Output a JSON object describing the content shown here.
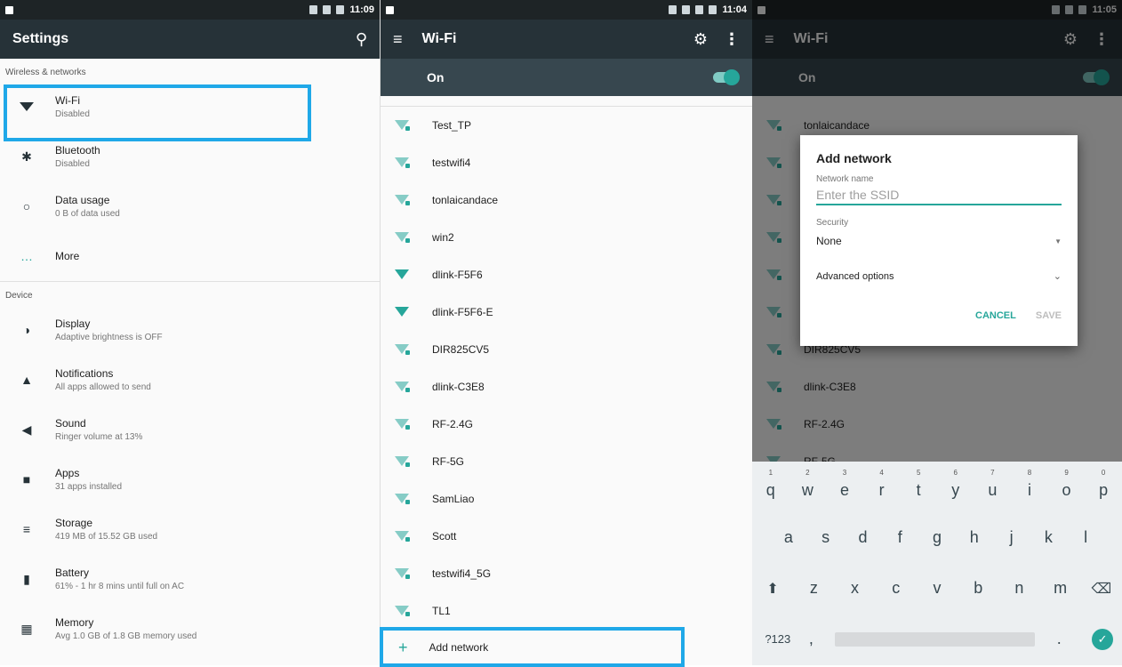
{
  "panel1": {
    "status_time": "11:09",
    "toolbar_title": "Settings",
    "sections": [
      {
        "header": "Wireless & networks",
        "items": [
          {
            "title": "Wi-Fi",
            "subtitle": "Disabled",
            "icon": "wifi-icon"
          },
          {
            "title": "Bluetooth",
            "subtitle": "Disabled",
            "icon": "bluetooth-icon"
          },
          {
            "title": "Data usage",
            "subtitle": "0 B of data used",
            "icon": "data-usage-icon"
          },
          {
            "title": "More",
            "subtitle": "",
            "icon": "more-icon"
          }
        ]
      },
      {
        "header": "Device",
        "items": [
          {
            "title": "Display",
            "subtitle": "Adaptive brightness is OFF",
            "icon": "brightness-icon"
          },
          {
            "title": "Notifications",
            "subtitle": "All apps allowed to send",
            "icon": "bell-icon"
          },
          {
            "title": "Sound",
            "subtitle": "Ringer volume at 13%",
            "icon": "volume-icon"
          },
          {
            "title": "Apps",
            "subtitle": "31 apps installed",
            "icon": "android-icon"
          },
          {
            "title": "Storage",
            "subtitle": "419 MB of 15.52 GB used",
            "icon": "storage-icon"
          },
          {
            "title": "Battery",
            "subtitle": "61% - 1 hr 8 mins until full on AC",
            "icon": "battery-icon"
          },
          {
            "title": "Memory",
            "subtitle": "Avg 1.0 GB of 1.8 GB memory used",
            "icon": "memory-icon"
          }
        ]
      }
    ]
  },
  "panel2": {
    "status_time": "11:04",
    "toolbar_title": "Wi-Fi",
    "switch_label": "On",
    "networks": [
      "Test_TP",
      "testwifi4",
      "tonlaicandace",
      "win2",
      "dlink-F5F6",
      "dlink-F5F6-E",
      "DIR825CV5",
      "dlink-C3E8",
      "RF-2.4G",
      "RF-5G",
      "SamLiao",
      "Scott",
      "testwifi4_5G",
      "TL1"
    ],
    "add_network": "Add network"
  },
  "panel3": {
    "status_time": "11:05",
    "toolbar_title": "Wi-Fi",
    "switch_label": "On",
    "background_networks": [
      "tonlaicandace",
      "DIR825CV5",
      "dlink-C3E8",
      "RF-2.4G",
      "RF-5G"
    ],
    "dialog": {
      "title": "Add network",
      "network_name_label": "Network name",
      "ssid_placeholder": "Enter the SSID",
      "security_label": "Security",
      "security_value": "None",
      "advanced_options": "Advanced options",
      "cancel": "CANCEL",
      "save": "SAVE"
    },
    "keyboard": {
      "row1": [
        "q",
        "w",
        "e",
        "r",
        "t",
        "y",
        "u",
        "i",
        "o",
        "p"
      ],
      "row1_hints": [
        "1",
        "2",
        "3",
        "4",
        "5",
        "6",
        "7",
        "8",
        "9",
        "0"
      ],
      "row2": [
        "a",
        "s",
        "d",
        "f",
        "g",
        "h",
        "j",
        "k",
        "l"
      ],
      "row3": [
        "z",
        "x",
        "c",
        "v",
        "b",
        "n",
        "m"
      ],
      "symbols_key": "?123",
      "comma": ",",
      "period": "."
    }
  },
  "colors": {
    "accent": "#26a69a",
    "toolbar": "#263238",
    "highlight": "#1fa8e8"
  }
}
